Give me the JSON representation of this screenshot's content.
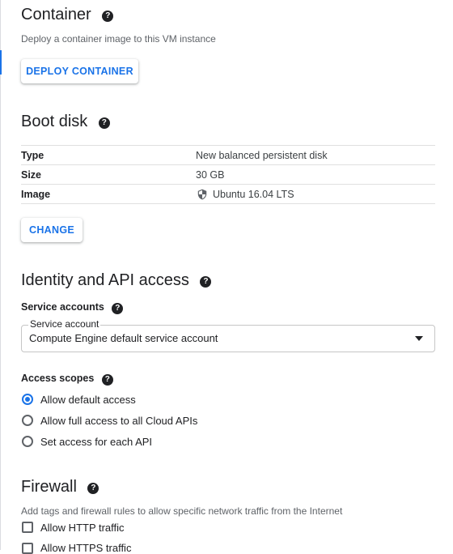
{
  "container": {
    "title": "Container",
    "description": "Deploy a container image to this VM instance",
    "deploy_label": "DEPLOY CONTAINER"
  },
  "boot_disk": {
    "title": "Boot disk",
    "rows": [
      {
        "label": "Type",
        "value": "New balanced persistent disk"
      },
      {
        "label": "Size",
        "value": "30 GB"
      },
      {
        "label": "Image",
        "value": "Ubuntu 16.04 LTS"
      }
    ],
    "change_label": "CHANGE"
  },
  "identity": {
    "title": "Identity and API access",
    "service_accounts_label": "Service accounts",
    "service_account_field_label": "Service account",
    "service_account_value": "Compute Engine default service account",
    "access_scopes_label": "Access scopes",
    "scopes": [
      {
        "label": "Allow default access",
        "selected": true
      },
      {
        "label": "Allow full access to all Cloud APIs",
        "selected": false
      },
      {
        "label": "Set access for each API",
        "selected": false
      }
    ]
  },
  "firewall": {
    "title": "Firewall",
    "description": "Add tags and firewall rules to allow specific network traffic from the Internet",
    "options": [
      {
        "label": "Allow HTTP traffic",
        "checked": false
      },
      {
        "label": "Allow HTTPS traffic",
        "checked": false
      }
    ]
  },
  "icons": {
    "help": "help-icon",
    "shield": "shield-icon",
    "dropdown": "chevron-down-icon"
  },
  "colors": {
    "accent": "#1a73e8",
    "text": "#202124",
    "muted": "#5f6368"
  }
}
